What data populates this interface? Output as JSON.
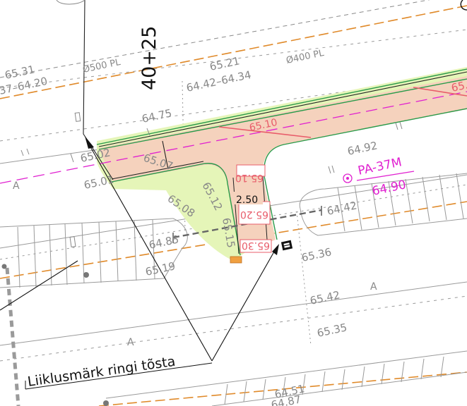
{
  "station": {
    "label": "40+25"
  },
  "pipes": {
    "left": "Ø500 PL",
    "right": "Ø400 PL"
  },
  "elevations": {
    "top_left_a": "65.31",
    "top_left_b": "37–64.20",
    "top_mid": "65.21",
    "top_mid_range": "64.42–64.34",
    "top_right_partial": "65.2",
    "road_a": "64.75",
    "road_b": "65.02",
    "road_c": "65.07",
    "road_d": "65.01",
    "island_a": "65.08",
    "island_b": "65.12",
    "island_c": "65.15",
    "sidewalk_a": "64.85",
    "sidewalk_b": "65.19",
    "right_a": "64.92",
    "right_b": "64.42",
    "right_c": "65.36",
    "right_d": "65.42",
    "right_e": "65.35",
    "bottom_a": "64.51",
    "bottom_b": "64.87"
  },
  "design_levels": {
    "d1": "65.10",
    "d2": "65.10",
    "d3": "65.20",
    "d4": "65.30"
  },
  "dimension": {
    "width": "2.50"
  },
  "well": {
    "id": "PA-37M",
    "level": "64.90"
  },
  "area_marks": {
    "a1": "A",
    "a2": "A",
    "a3": "A"
  },
  "callout": {
    "text": "Liiklusmärk ringi tõsta"
  },
  "colors": {
    "paving": "#f5d2bd",
    "green_zone": "#e5f5b8",
    "curb": "#2a9a4a",
    "design_red": "#e85c6a",
    "magenta": "#e020d0",
    "orange_line": "#e08a2a",
    "gray": "#8a8a8a"
  },
  "icons": [
    "traffic-sign-icon",
    "well-marker-icon",
    "lamp-post-icon"
  ]
}
